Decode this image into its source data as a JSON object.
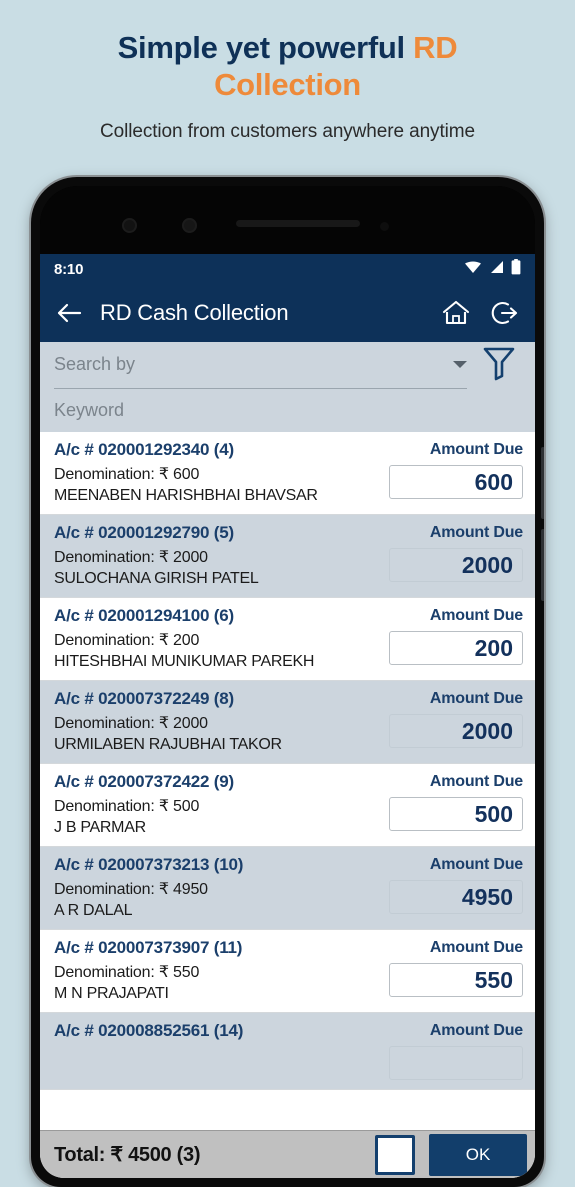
{
  "promo": {
    "title_lead": "Simple yet powerful ",
    "title_accent": "RD Collection",
    "subtitle": "Collection from customers anywhere anytime",
    "accent_color": "#ee8a3a",
    "title_color": "#0f3157",
    "background_color": "#c9dde4"
  },
  "statusbar": {
    "time": "8:10",
    "icons": [
      "wifi-icon",
      "signal-icon",
      "battery-icon"
    ]
  },
  "appbar": {
    "back_icon": "back-arrow-icon",
    "title": "RD Cash Collection",
    "home_icon": "home-icon",
    "logout_icon": "logout-icon",
    "background_color": "#0d3159"
  },
  "search": {
    "select_placeholder": "Search by",
    "select_value": "",
    "caret_icon": "chevron-down-icon",
    "filter_icon": "filter-funnel-icon",
    "keyword_placeholder": "Keyword",
    "keyword_value": ""
  },
  "list": {
    "amount_due_label": "Amount Due",
    "denomination_prefix": "Denomination: ₹ ",
    "account_prefix": "A/c # ",
    "rows": [
      {
        "account": "A/c # 020001292340 (4)",
        "denomination": "Denomination: ₹ 600",
        "customer": "MEENABEN HARISHBHAI BHAVSAR",
        "amount_label": "Amount Due",
        "amount": "600"
      },
      {
        "account": "A/c # 020001292790 (5)",
        "denomination": "Denomination: ₹ 2000",
        "customer": "SULOCHANA GIRISH PATEL",
        "amount_label": "Amount Due",
        "amount": "2000"
      },
      {
        "account": "A/c # 020001294100 (6)",
        "denomination": "Denomination: ₹ 200",
        "customer": "HITESHBHAI MUNIKUMAR PAREKH",
        "amount_label": "Amount Due",
        "amount": "200"
      },
      {
        "account": "A/c # 020007372249 (8)",
        "denomination": "Denomination: ₹ 2000",
        "customer": "URMILABEN RAJUBHAI TAKOR",
        "amount_label": "Amount Due",
        "amount": "2000"
      },
      {
        "account": "A/c # 020007372422 (9)",
        "denomination": "Denomination: ₹ 500",
        "customer": "J B PARMAR",
        "amount_label": "Amount Due",
        "amount": "500"
      },
      {
        "account": "A/c # 020007373213 (10)",
        "denomination": "Denomination: ₹ 4950",
        "customer": "A R DALAL",
        "amount_label": "Amount Due",
        "amount": "4950"
      },
      {
        "account": "A/c # 020007373907 (11)",
        "denomination": "Denomination: ₹ 550",
        "customer": "M N PRAJAPATI",
        "amount_label": "Amount Due",
        "amount": "550"
      },
      {
        "account": "A/c # 020008852561 (14)",
        "denomination": "",
        "customer": "",
        "amount_label": "Amount Due",
        "amount": ""
      }
    ]
  },
  "footer": {
    "total": "Total: ₹ 4500 (3)",
    "checkbox_checked": false,
    "ok_label": "OK",
    "ok_color": "#123e6b"
  }
}
